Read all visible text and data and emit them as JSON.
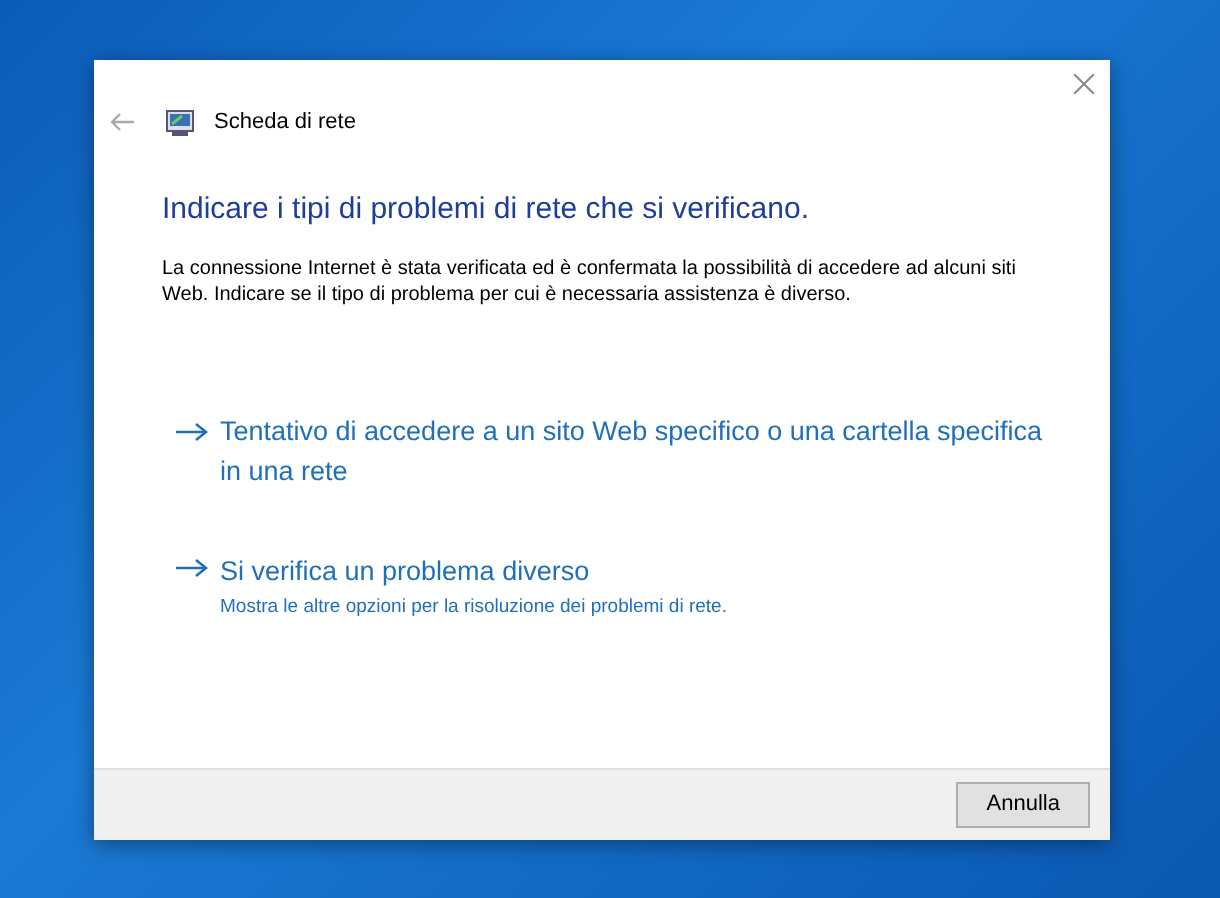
{
  "window": {
    "title": "Scheda di rete"
  },
  "heading": "Indicare i tipi di problemi di rete che si verificano.",
  "description": "La connessione Internet è stata verificata ed è confermata la possibilità di accedere ad alcuni siti Web. Indicare se il tipo di problema per cui è necessaria assistenza è diverso.",
  "options": [
    {
      "label": "Tentativo di accedere a un sito Web specifico o una cartella specifica in una rete"
    },
    {
      "label": "Si verifica un problema diverso",
      "detail": "Mostra le altre opzioni per la risoluzione dei problemi di rete."
    }
  ],
  "buttons": [
    "Annulla"
  ]
}
